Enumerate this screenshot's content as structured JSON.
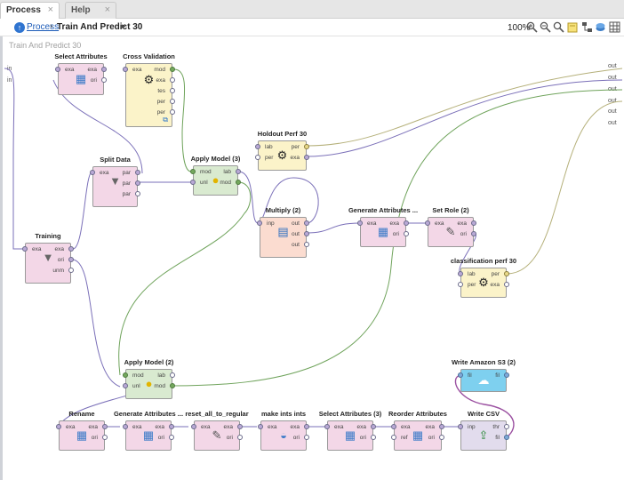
{
  "tabs": [
    {
      "label": "Process",
      "active": true
    },
    {
      "label": "Help",
      "active": false
    }
  ],
  "breadcrumb": {
    "root": "Process",
    "current": "Train And Predict 30"
  },
  "toolbar": {
    "zoom": "100%"
  },
  "canvas": {
    "title": "Train And Predict 30",
    "left_ports": [
      "in",
      "in"
    ],
    "right_ports": [
      "out",
      "out",
      "out",
      "out",
      "out",
      "out"
    ]
  },
  "operators": {
    "select_attributes": {
      "title": "Select Attributes",
      "in": [
        "exa"
      ],
      "out": [
        "exa",
        "ori"
      ]
    },
    "cross_validation": {
      "title": "Cross Validation",
      "in": [
        "exa"
      ],
      "out": [
        "mod",
        "exa",
        "tes",
        "per",
        "per"
      ]
    },
    "holdout_perf": {
      "title": "Holdout Perf 30",
      "in": [
        "lab",
        "per"
      ],
      "out": [
        "per",
        "exa"
      ]
    },
    "split_data": {
      "title": "Split Data",
      "in": [
        "exa"
      ],
      "out": [
        "par",
        "par",
        "par"
      ]
    },
    "apply_model_3": {
      "title": "Apply Model (3)",
      "in": [
        "mod",
        "unl"
      ],
      "out": [
        "lab",
        "mod"
      ]
    },
    "training": {
      "title": "Training",
      "in": [
        "exa"
      ],
      "out": [
        "exa",
        "ori",
        "unm"
      ]
    },
    "multiply_2": {
      "title": "Multiply (2)",
      "in": [
        "inp"
      ],
      "out": [
        "out",
        "out",
        "out"
      ]
    },
    "generate_attributes_top": {
      "title": "Generate Attributes ...",
      "in": [
        "exa"
      ],
      "out": [
        "exa",
        "ori"
      ]
    },
    "set_role_2": {
      "title": "Set Role (2)",
      "in": [
        "exa"
      ],
      "out": [
        "exa",
        "ori"
      ]
    },
    "classification_perf": {
      "title": "classification perf 30",
      "in": [
        "lab",
        "per"
      ],
      "out": [
        "per",
        "exa"
      ]
    },
    "apply_model_2": {
      "title": "Apply Model (2)",
      "in": [
        "mod",
        "unl"
      ],
      "out": [
        "lab",
        "mod"
      ]
    },
    "write_amazon_s3": {
      "title": "Write Amazon S3 (2)",
      "in": [
        "fil"
      ],
      "out": [
        "fil"
      ]
    },
    "rename": {
      "title": "Rename",
      "in": [
        "exa"
      ],
      "out": [
        "exa",
        "ori"
      ]
    },
    "generate_attributes_bottom": {
      "title": "Generate Attributes ...",
      "in": [
        "exa"
      ],
      "out": [
        "exa",
        "ori"
      ]
    },
    "reset_all_to_regular": {
      "title": "reset_all_to_regular",
      "in": [
        "exa"
      ],
      "out": [
        "exa",
        "ori"
      ]
    },
    "make_ints_ints": {
      "title": "make ints ints",
      "in": [
        "exa"
      ],
      "out": [
        "exa",
        "ori"
      ]
    },
    "select_attributes_3": {
      "title": "Select Attributes (3)",
      "in": [
        "exa"
      ],
      "out": [
        "exa",
        "ori"
      ]
    },
    "reorder_attributes": {
      "title": "Reorder Attributes",
      "in": [
        "exa",
        "ref"
      ],
      "out": [
        "exa",
        "ori"
      ]
    },
    "write_csv": {
      "title": "Write CSV",
      "in": [
        "inp"
      ],
      "out": [
        "thr",
        "fil"
      ]
    }
  },
  "colors": {
    "wire_example": "#7a6fb8",
    "wire_model": "#6fa35b",
    "wire_perf": "#b5b07a",
    "wire_file": "#9a4fa0"
  }
}
